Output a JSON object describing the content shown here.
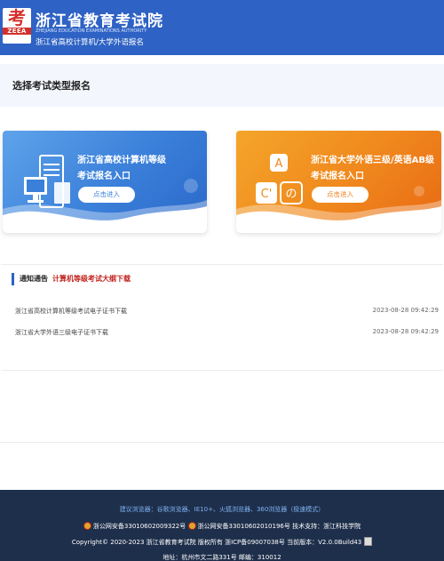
{
  "header": {
    "logo_mark": "考",
    "logo_abbr": "ZEEA",
    "logo_tagline": "Zhejiang Education Examinations Authority",
    "title": "浙江省教育考试院",
    "title_en": "ZHEJIANG EDUCATION EXAMINATIONS AUTHORITY",
    "subtitle": "浙江省高校计算机/大学外语报名"
  },
  "section": {
    "title": "选择考试类型报名"
  },
  "cards": [
    {
      "line1": "浙江省高校计算机等级",
      "line2": "考试报名入口",
      "button": "点击进入",
      "icon": "computer-server-icon"
    },
    {
      "line1": "浙江省大学外语三级/英语AB级",
      "line2": "考试报名入口",
      "button": "点击进入",
      "icon": "language-letters-icon",
      "glyphs": [
        "A",
        "C'",
        "の"
      ]
    }
  ],
  "notice": {
    "heading": "通知通告",
    "link": "计算机等级考试大纲下载",
    "items": [
      {
        "text": "浙江省高校计算机等级考试电子证书下载",
        "date": "2023-08-28 09:42:29"
      },
      {
        "text": "浙江省大学外语三级电子证书下载",
        "date": "2023-08-28 09:42:29"
      }
    ]
  },
  "footer": {
    "browsers": "建议浏览器：谷歌浏览器、IE10+、火狐浏览器、360浏览器（极速模式）",
    "icp1": "浙公网安备33010602009322号",
    "icp2": "浙公网安备33010602010196号 技术支持：浙江科技学院",
    "copyright": "Copyright© 2020-2023 浙江省教育考试院 版权所有 浙ICP备09007038号 当前版本：V2.0.0Build43",
    "address": "地址：杭州市文二路331号 邮编：310012"
  },
  "colors": {
    "header_blue": "#2e62c4",
    "card_blue": "#3a7fd9",
    "card_orange": "#f08a1e",
    "notice_red": "#c0211c",
    "footer_bg": "#1e2f4b"
  }
}
